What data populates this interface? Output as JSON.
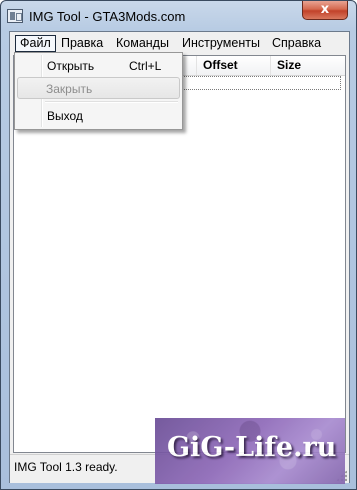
{
  "window": {
    "title": "IMG Tool - GTA3Mods.com",
    "close_glyph": "x"
  },
  "menubar": {
    "items": [
      {
        "label": "Файл",
        "active": true
      },
      {
        "label": "Правка"
      },
      {
        "label": "Команды"
      },
      {
        "label": "Инструменты"
      },
      {
        "label": "Справка"
      }
    ]
  },
  "file_menu": {
    "items": [
      {
        "label": "Открыть",
        "shortcut": "Ctrl+L",
        "enabled": true
      },
      {
        "label": "Закрыть",
        "shortcut": "",
        "enabled": false
      },
      {
        "label": "Выход",
        "shortcut": "",
        "enabled": true
      }
    ]
  },
  "listview": {
    "columns": [
      "Offset",
      "Size"
    ],
    "rows": []
  },
  "statusbar": {
    "text": "IMG Tool 1.3 ready."
  },
  "watermark": {
    "text": "GiG-Life.ru"
  },
  "colors": {
    "titlebar": "#b7cbe3",
    "close_button": "#c1422a",
    "watermark_bg": "#8f6ab9"
  }
}
